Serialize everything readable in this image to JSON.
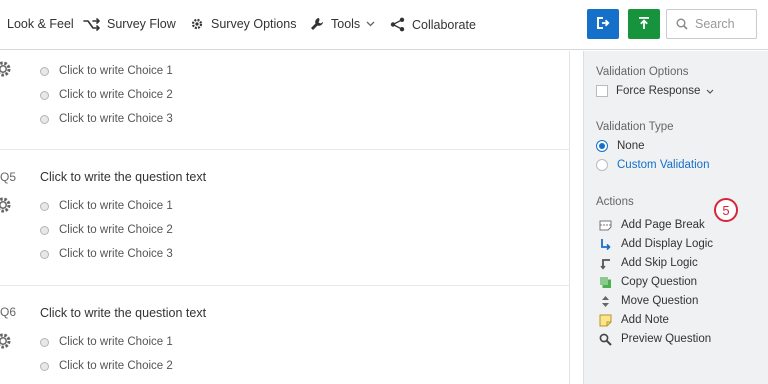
{
  "toolbar": {
    "look_feel": "Look & Feel",
    "survey_flow": "Survey Flow",
    "survey_options": "Survey Options",
    "tools": "Tools",
    "collaborate": "Collaborate",
    "search_placeholder": "Search"
  },
  "questions": [
    {
      "number": "",
      "text": "",
      "choices": [
        "Click to write Choice 1",
        "Click to write Choice 2",
        "Click to write Choice 3"
      ]
    },
    {
      "number": "Q5",
      "text": "Click to write the question text",
      "choices": [
        "Click to write Choice 1",
        "Click to write Choice 2",
        "Click to write Choice 3"
      ]
    },
    {
      "number": "Q6",
      "text": "Click to write the question text",
      "choices": [
        "Click to write Choice 1",
        "Click to write Choice 2"
      ]
    }
  ],
  "sidebar": {
    "validation_options": "Validation Options",
    "force_response": "Force Response",
    "validation_type": "Validation Type",
    "none": "None",
    "custom_validation": "Custom Validation",
    "actions": "Actions",
    "action_items": [
      "Add Page Break",
      "Add Display Logic",
      "Add Skip Logic",
      "Copy Question",
      "Move Question",
      "Add Note",
      "Preview Question"
    ]
  },
  "badge": "5",
  "colors": {
    "accent_blue": "#1470c8",
    "publish_green": "#17933e",
    "badge_red": "#d6243b"
  }
}
